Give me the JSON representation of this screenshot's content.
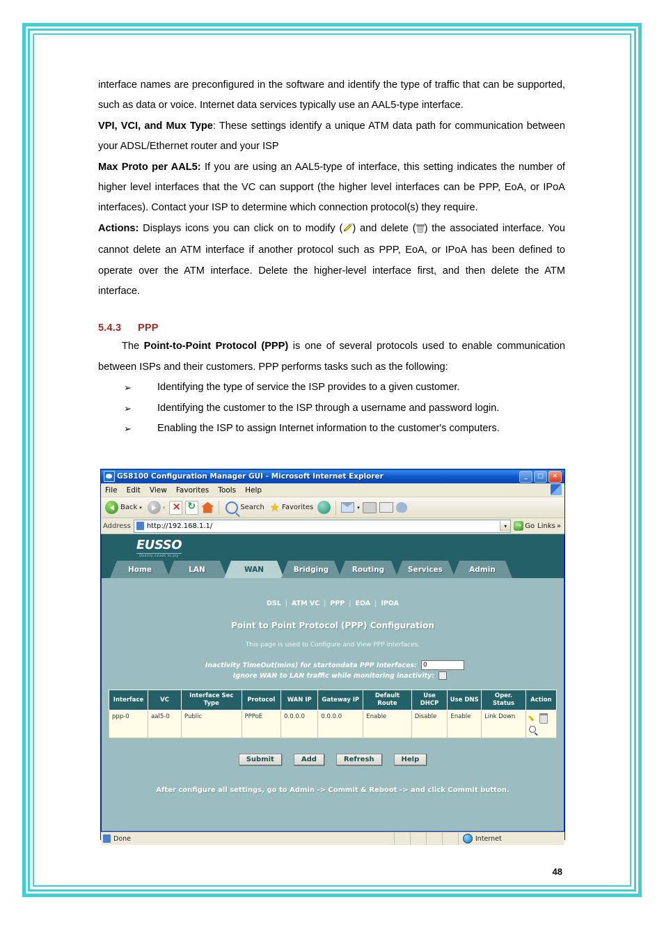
{
  "document": {
    "paragraphs": [
      {
        "id": "p1",
        "text": "interface names are preconfigured in the software and identify the type of traffic that can be supported, such as data or voice. Internet data services typically use an AAL5-type interface."
      },
      {
        "id": "p2",
        "bold_lead": "VPI, VCI, and Mux Type",
        "text": ": These settings identify a unique ATM data path for communication between your ADSL/Ethernet router and your ISP"
      },
      {
        "id": "p3",
        "bold_lead": "Max Proto per AAL5:",
        "text": " If you are using an AAL5-type of interface, this setting indicates the number of higher level interfaces that the VC can support (the higher level interfaces can be PPP, EoA, or IPoA interfaces). Contact your ISP to determine which connection protocol(s) they require."
      },
      {
        "id": "p4",
        "bold_lead": "Actions:",
        "text_part1": " Displays icons you can click on to modify (",
        "text_part2": ") and delete (",
        "text_part3": ") the associated interface. You cannot delete an ATM interface if another protocol such as PPP, EoA, or IPoA has been defined to operate over the ATM interface. Delete the higher-level interface first, and then delete the ATM interface."
      }
    ],
    "section": {
      "number": "5.4.3",
      "title": "PPP"
    },
    "intro": {
      "lead": "The ",
      "bold": "Point-to-Point Protocol (PPP)",
      "rest": " is one of several protocols used to enable communication between ISPs and their customers. PPP performs tasks such as the following:"
    },
    "bullets": [
      "Identifying the type of service the ISP provides to a given customer.",
      "Identifying the customer to the ISP through a username and password login.",
      "Enabling the ISP to assign Internet information to the customer's computers."
    ],
    "bullet_marker": "➢",
    "page_number": "48"
  },
  "browser": {
    "title": "GS8100 Configuration Manager GUI - Microsoft Internet Explorer",
    "window_buttons": {
      "minimize": "_",
      "maximize": "□",
      "close": "✕"
    },
    "menus": [
      "File",
      "Edit",
      "View",
      "Favorites",
      "Tools",
      "Help"
    ],
    "toolbar": {
      "back": "Back",
      "back_caret": "▾",
      "forward_caret": "▾",
      "search": "Search",
      "favorites": "Favorites"
    },
    "address": {
      "label": "Address",
      "url": "http://192.168.1.1/",
      "dropdown_caret": "▾",
      "go": "Go",
      "go_arrow": "→",
      "links": "Links",
      "links_caret": "»"
    },
    "statusbar": {
      "status": "Done",
      "zone": "Internet"
    }
  },
  "gui": {
    "logo": "EUSSO",
    "logo_tagline": "Quality Leads to Joy",
    "tabs": [
      {
        "label": "Home",
        "active": false
      },
      {
        "label": "LAN",
        "active": false
      },
      {
        "label": "WAN",
        "active": true
      },
      {
        "label": "Bridging",
        "active": false
      },
      {
        "label": "Routing",
        "active": false
      },
      {
        "label": "Services",
        "active": false
      },
      {
        "label": "Admin",
        "active": false
      }
    ],
    "subnav": [
      "DSL",
      "ATM VC",
      "PPP",
      "EOA",
      "IPOA"
    ],
    "subnav_separator": "|",
    "page_title": "Point to Point Protocol (PPP) Configuration",
    "page_description": "This page is used to Configure and View PPP interfaces.",
    "form": {
      "timeout_label": "Inactivity TimeOut(mins) for startondata PPP Interfaces:",
      "timeout_value": "0",
      "ignore_label": "Ignore WAN to LAN traffic while monitoring inactivity:",
      "ignore_checked": false
    },
    "table": {
      "columns": [
        "Interface",
        "VC",
        "Interface Sec Type",
        "Protocol",
        "WAN IP",
        "Gateway IP",
        "Default Route",
        "Use DHCP",
        "Use DNS",
        "Oper. Status",
        "Action"
      ],
      "rows": [
        {
          "interface": "ppp-0",
          "vc": "aal5-0",
          "sec_type": "Public",
          "protocol": "PPPoE",
          "wan_ip": "0.0.0.0",
          "gateway_ip": "0.0.0.0",
          "default_route": "Enable",
          "use_dhcp": "Disable",
          "use_dns": "Enable",
          "oper_status": "Link Down"
        }
      ]
    },
    "buttons": [
      "Submit",
      "Add",
      "Refresh",
      "Help"
    ],
    "footer_note": "After configure all settings, go to Admin -> Commit & Reboot -> and click Commit button."
  },
  "colors": {
    "frame": "#3fd0d4",
    "section_heading": "#9e2b25",
    "gui_dark_teal": "#236068",
    "gui_body": "#9bbdc0",
    "tab_inactive": "#6d949a",
    "tab_active": "#b8d2d4",
    "table_row_bg": "#fffde8",
    "link_down": "#c9b96b"
  }
}
